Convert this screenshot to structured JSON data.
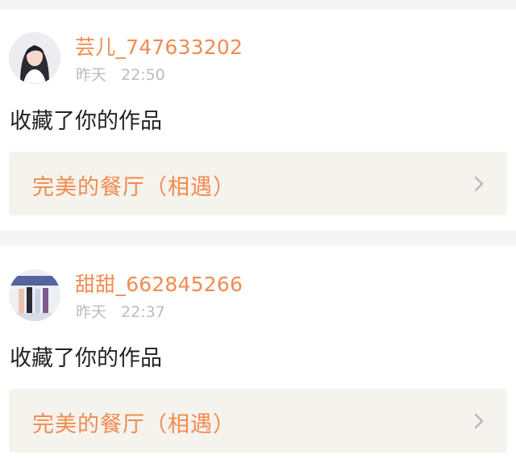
{
  "notifications": [
    {
      "user": "芸儿_747633202",
      "date": "昨天",
      "time": "22:50",
      "action": "收藏了你的作品",
      "work_title": "完美的餐厅（相遇）",
      "avatar_icon": "user-avatar-girl"
    },
    {
      "user": "甜甜_662845266",
      "date": "昨天",
      "time": "22:37",
      "action": "收藏了你的作品",
      "work_title": "完美的餐厅（相遇）",
      "avatar_icon": "user-avatar-group"
    }
  ],
  "colors": {
    "accent": "#f28b4e",
    "muted": "#bcbcbc",
    "work_bg": "#f4f3ee",
    "page_bg": "#f5f5f5"
  }
}
